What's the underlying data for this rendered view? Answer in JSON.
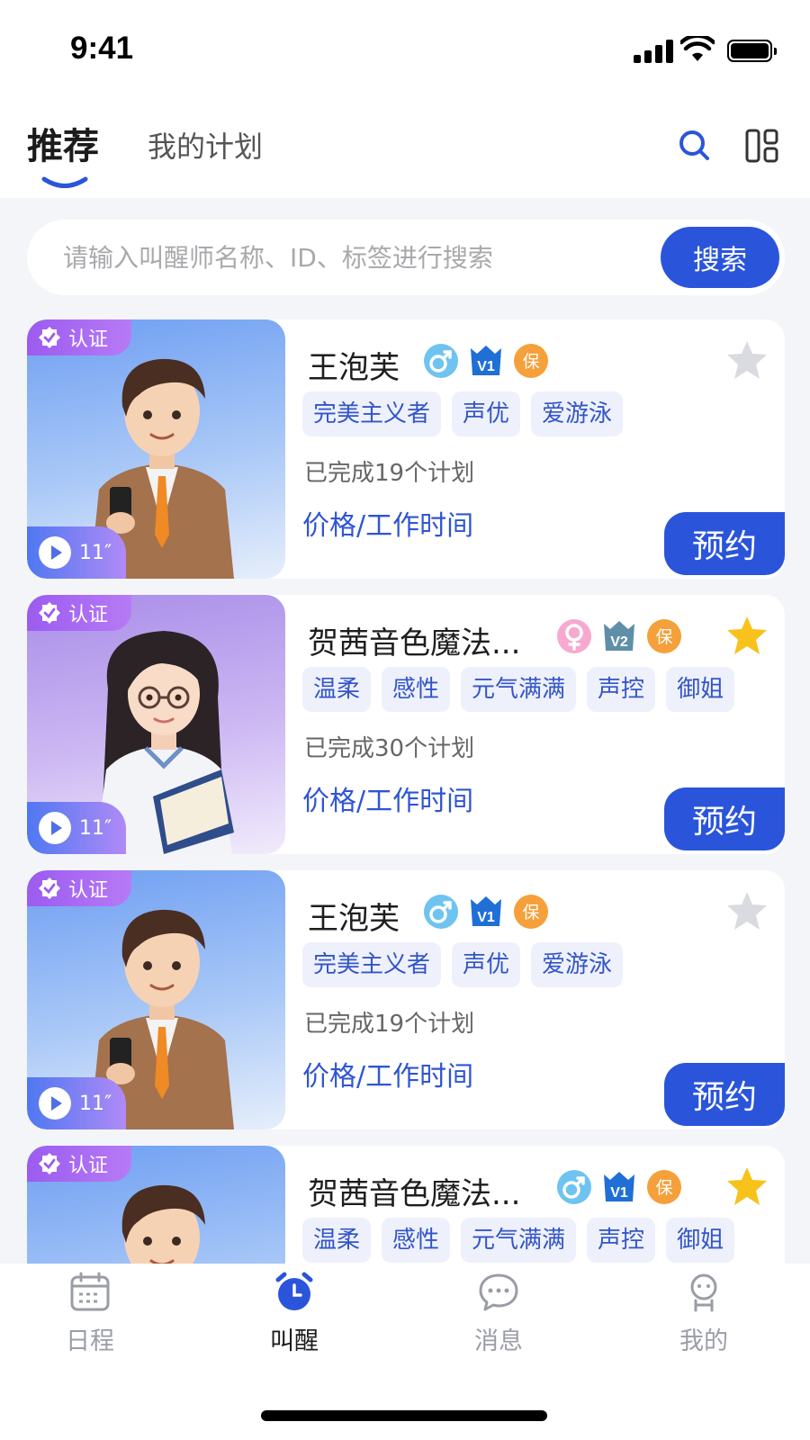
{
  "status_bar": {
    "time": "9:41"
  },
  "header": {
    "tabs": [
      {
        "label": "推荐",
        "active": true
      },
      {
        "label": "我的计划",
        "active": false
      }
    ],
    "icons": [
      "search-icon",
      "layout-icon"
    ]
  },
  "search": {
    "placeholder": "请输入叫醒师名称、ID、标签进行搜索",
    "value": "",
    "button_label": "搜索"
  },
  "cards": [
    {
      "verified_label": "认证",
      "voice_duration": "11″",
      "name": "王泡芙",
      "gender": "male",
      "level": "V1",
      "guarantee": "保",
      "favorited": false,
      "tags": [
        "完美主义者",
        "声优",
        "爱游泳"
      ],
      "completed": "已完成19个计划",
      "price_link": "价格/工作时间",
      "book_label": "预约"
    },
    {
      "verified_label": "认证",
      "voice_duration": "11″",
      "name": "贺茜音色魔法...",
      "gender": "female",
      "level": "V2",
      "guarantee": "保",
      "favorited": true,
      "tags": [
        "温柔",
        "感性",
        "元气满满",
        "声控",
        "御姐"
      ],
      "completed": "已完成30个计划",
      "price_link": "价格/工作时间",
      "book_label": "预约"
    },
    {
      "verified_label": "认证",
      "voice_duration": "11″",
      "name": "王泡芙",
      "gender": "male",
      "level": "V1",
      "guarantee": "保",
      "favorited": false,
      "tags": [
        "完美主义者",
        "声优",
        "爱游泳"
      ],
      "completed": "已完成19个计划",
      "price_link": "价格/工作时间",
      "book_label": "预约"
    },
    {
      "verified_label": "认证",
      "voice_duration": "",
      "name": "贺茜音色魔法...",
      "gender": "male",
      "level": "V1",
      "guarantee": "保",
      "favorited": true,
      "tags": [
        "温柔",
        "感性",
        "元气满满",
        "声控",
        "御姐"
      ],
      "completed": "",
      "price_link": "",
      "book_label": ""
    }
  ],
  "bottom_nav": [
    {
      "label": "日程",
      "icon": "calendar-icon",
      "active": false
    },
    {
      "label": "叫醒",
      "icon": "alarm-clock-icon",
      "active": true
    },
    {
      "label": "消息",
      "icon": "chat-icon",
      "active": false
    },
    {
      "label": "我的",
      "icon": "profile-icon",
      "active": false
    }
  ],
  "colors": {
    "primary": "#2a55db",
    "tag_bg": "#eef1fb",
    "verified": "#9b5cf0",
    "star_active": "#f7c21b",
    "star_inactive": "#d9dbe0"
  }
}
